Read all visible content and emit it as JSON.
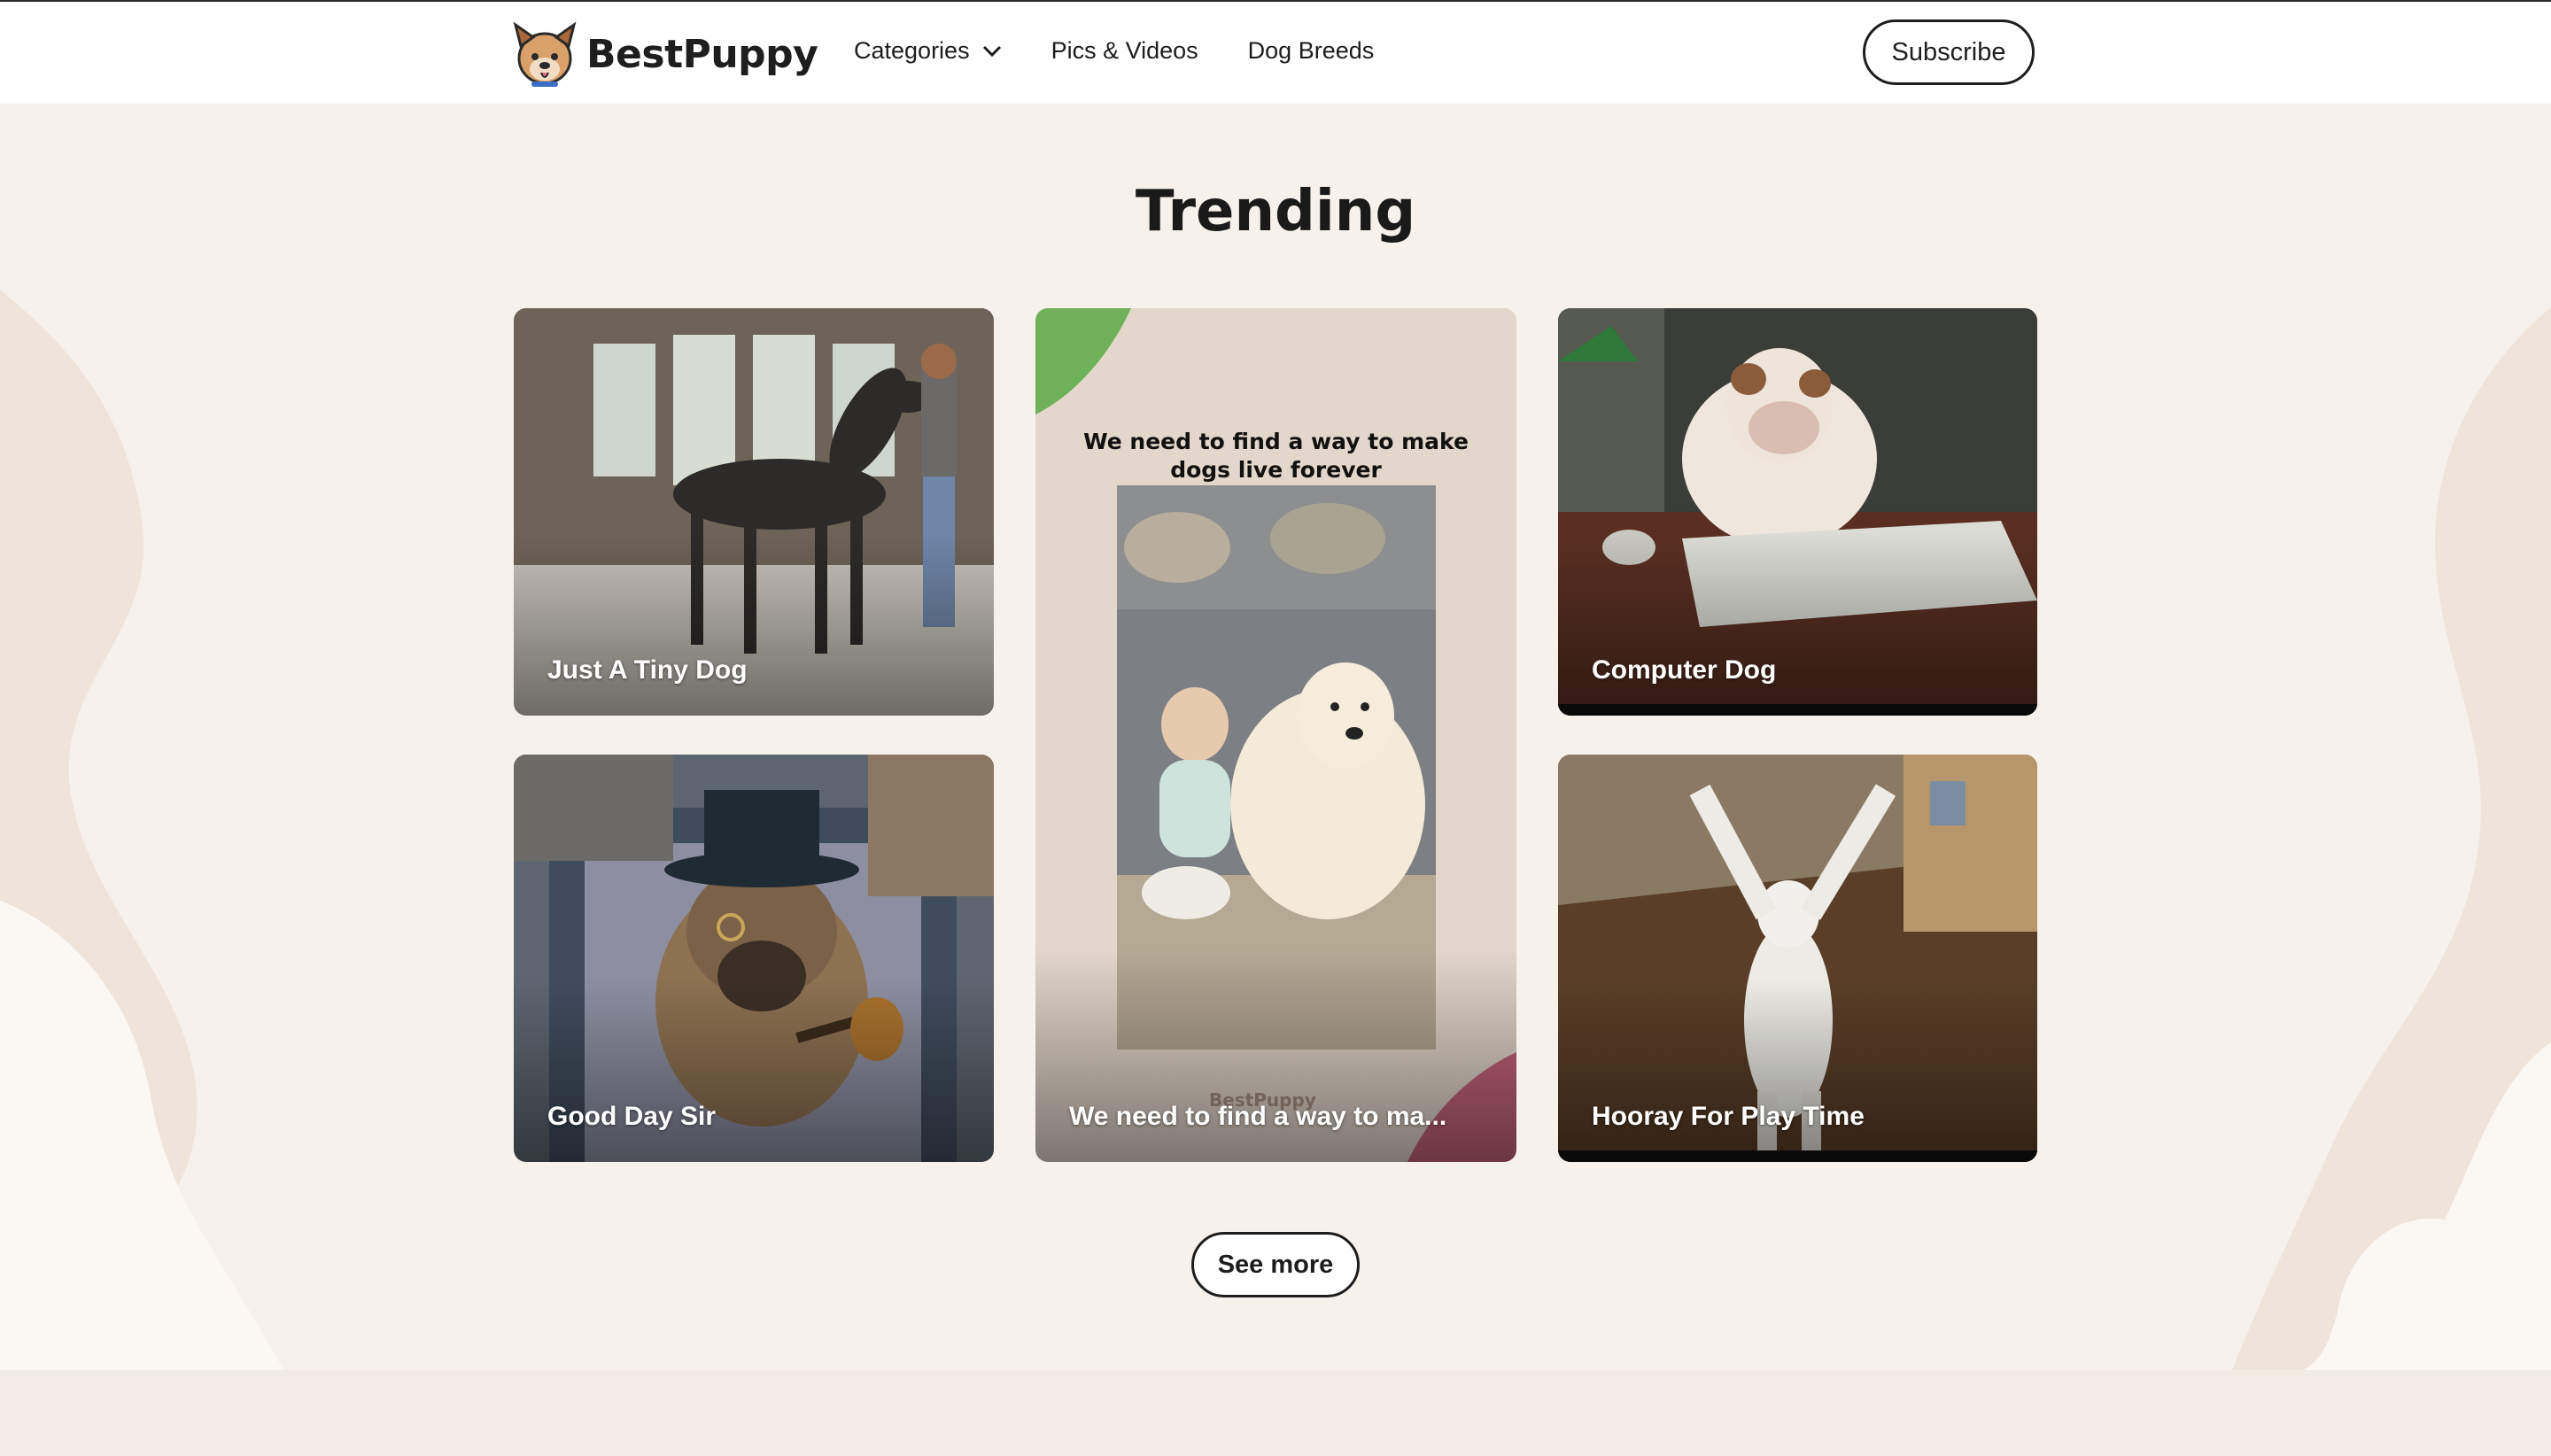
{
  "header": {
    "brand": "BestPuppy",
    "nav": [
      {
        "label": "Categories",
        "has_dropdown": true
      },
      {
        "label": "Pics & Videos"
      },
      {
        "label": "Dog Breeds"
      }
    ],
    "subscribe_label": "Subscribe"
  },
  "main": {
    "heading": "Trending",
    "cards": [
      {
        "title": "Just A Tiny Dog"
      },
      {
        "title": "We need to find a way to ma...",
        "caption_line1": "We need to find a way to make",
        "caption_line2": "dogs live forever",
        "watermark": "BestPuppy"
      },
      {
        "title": "Computer Dog"
      },
      {
        "title": "Good Day Sir"
      },
      {
        "title": "Hooray For Play Time"
      }
    ],
    "see_more_label": "See more"
  },
  "colors": {
    "background": "#f7f1eb",
    "header": "#ffffff",
    "text": "#1d1d1d",
    "blob": "#efe4da"
  }
}
